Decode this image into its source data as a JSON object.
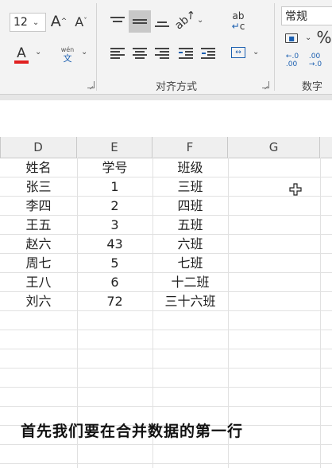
{
  "ribbon": {
    "font_size": "12",
    "font_color_letter": "A",
    "increase_font_letter": "A",
    "decrease_font_letter": "A",
    "phonetic_top": "wén",
    "phonetic_bottom": "文",
    "number_format": "常规",
    "percent_symbol": "%",
    "inc_decimal": "←.0\n.00",
    "dec_decimal": ".00\n→.0",
    "wrap_text_top": "ab",
    "wrap_text_bottom": "c",
    "alignment_group_label": "对齐方式",
    "number_group_label": "数字",
    "colors": {
      "font_color_bar": "#e02020",
      "selected_button_bg": "#c8c8c8"
    }
  },
  "columns": [
    "D",
    "E",
    "F",
    "G"
  ],
  "rows": [
    {
      "name": "姓名",
      "id": "学号",
      "class": "班级"
    },
    {
      "name": "张三",
      "id": "1",
      "class": "三班"
    },
    {
      "name": "李四",
      "id": "2",
      "class": "四班"
    },
    {
      "name": "王五",
      "id": "3",
      "class": "五班"
    },
    {
      "name": "赵六",
      "id": "43",
      "class": "六班"
    },
    {
      "name": "周七",
      "id": "5",
      "class": "七班"
    },
    {
      "name": "王八",
      "id": "6",
      "class": "十二班"
    },
    {
      "name": "刘六",
      "id": "72",
      "class": "三十六班"
    }
  ],
  "caption": "首先我们要在合并数据的第一行"
}
